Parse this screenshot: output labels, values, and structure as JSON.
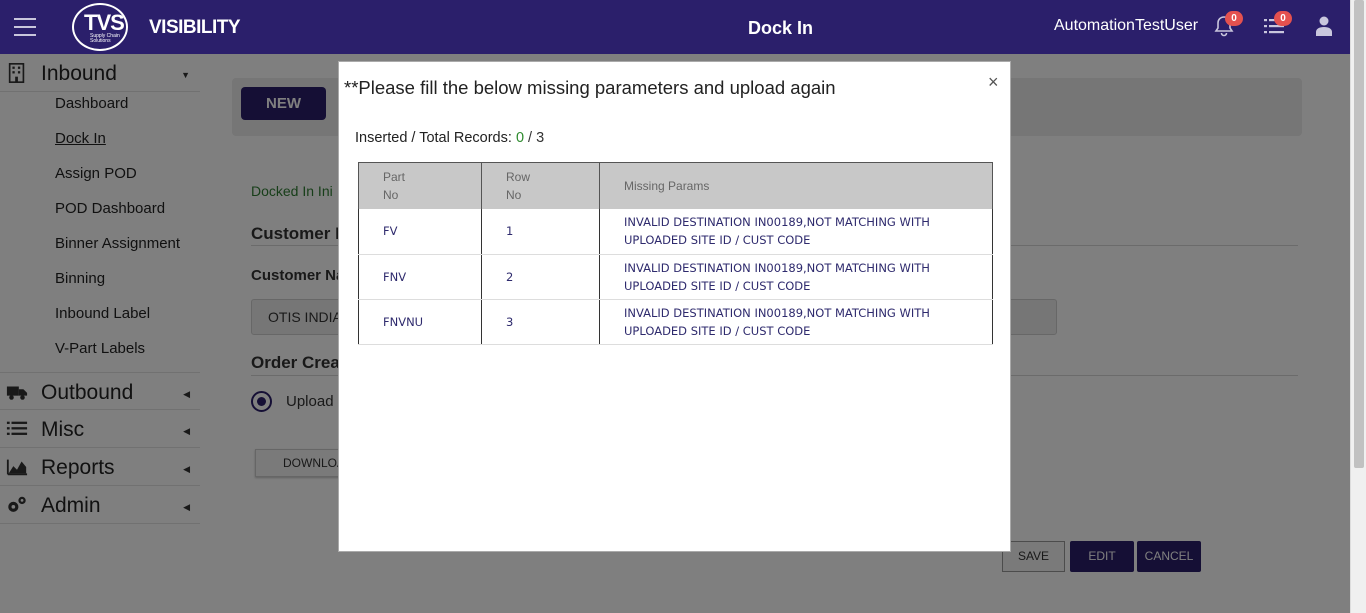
{
  "header": {
    "logo_text": "TVS",
    "logo_subtext": "Supply Chain Solutions",
    "brand": "VISIBILITY",
    "page_title": "Dock In",
    "username": "AutomationTestUser",
    "notifications_count": "0",
    "tasks_count": "0"
  },
  "sidebar": {
    "sections": [
      {
        "label": "Inbound",
        "icon": "building-icon",
        "expanded": true
      },
      {
        "label": "Outbound",
        "icon": "truck-icon",
        "expanded": false
      },
      {
        "label": "Misc",
        "icon": "list-icon",
        "expanded": false
      },
      {
        "label": "Reports",
        "icon": "area-chart-icon",
        "expanded": false
      },
      {
        "label": "Admin",
        "icon": "gears-icon",
        "expanded": false
      }
    ],
    "inbound_items": [
      {
        "label": "Dashboard",
        "active": false
      },
      {
        "label": "Dock In",
        "active": true
      },
      {
        "label": "Assign POD",
        "active": false
      },
      {
        "label": "POD Dashboard",
        "active": false
      },
      {
        "label": "Binner Assignment",
        "active": false
      },
      {
        "label": "Binning",
        "active": false
      },
      {
        "label": "Inbound Label",
        "active": false
      },
      {
        "label": "V-Part Labels",
        "active": false
      }
    ]
  },
  "main": {
    "new_button": "NEW",
    "status_text": "Docked In Ini",
    "customer_heading": "Customer In",
    "customer_name_label": "Customer Na",
    "customer_value": "OTIS INDIA",
    "order_heading": "Order Creat",
    "upload_option": "Upload",
    "download_button": "DOWNLOA",
    "save_button": "SAVE",
    "edit_button": "EDIT",
    "cancel_button": "CANCEL"
  },
  "modal": {
    "title": "**Please fill the below missing parameters and upload again",
    "close": "×",
    "records_label": "Inserted / Total Records:",
    "inserted": "0",
    "separator": "/",
    "total": "3",
    "columns": {
      "part_no_1": "Part",
      "part_no_2": "No",
      "row_no_1": "Row",
      "row_no_2": "No",
      "missing": "Missing Params"
    },
    "rows": [
      {
        "part": "FV",
        "row": "1",
        "missing": "INVALID DESTINATION IN00189,NOT MATCHING WITH UPLOADED SITE ID / CUST CODE"
      },
      {
        "part": "FNV",
        "row": "2",
        "missing": "INVALID DESTINATION IN00189,NOT MATCHING WITH UPLOADED SITE ID / CUST CODE"
      },
      {
        "part": "FNVNU",
        "row": "3",
        "missing": "INVALID DESTINATION IN00189,NOT MATCHING WITH UPLOADED SITE ID / CUST CODE"
      }
    ]
  },
  "colors": {
    "header_bg": "#2b1f6b",
    "badge": "#e4514f",
    "success_text": "#2e8b2e",
    "table_text": "#2e2a6d"
  }
}
